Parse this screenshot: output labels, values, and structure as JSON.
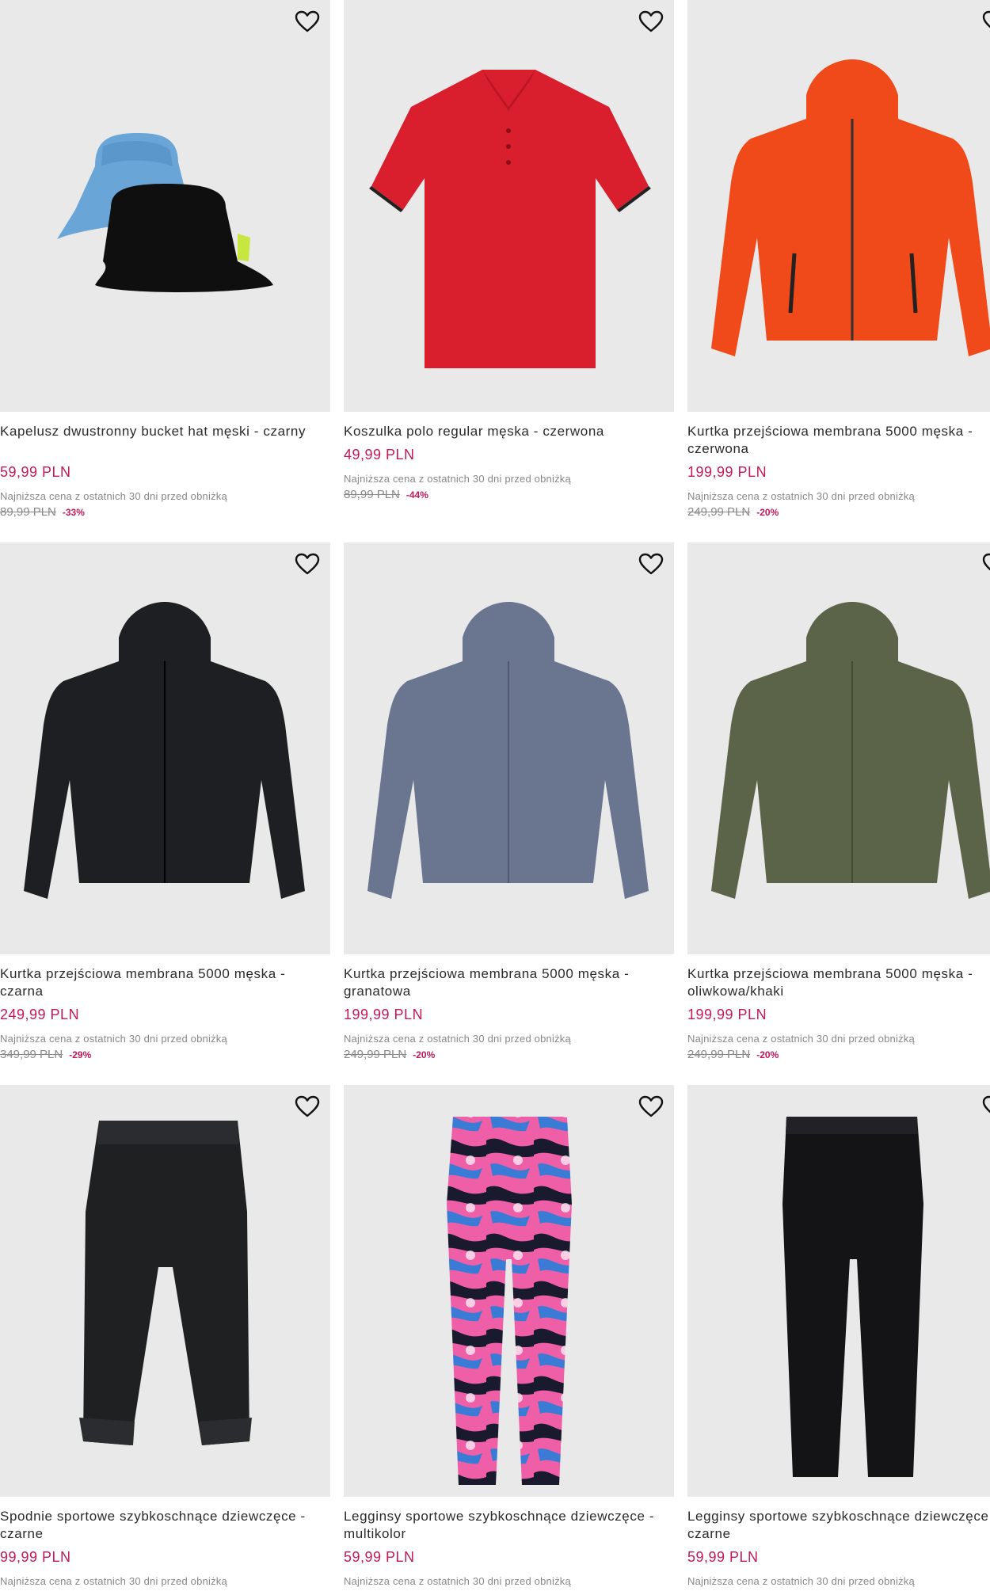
{
  "colors": {
    "price": "#c2185b",
    "tile_bg": "#e9e9e9",
    "muted": "#888888"
  },
  "icons": {
    "favorite": "heart-outline-icon"
  },
  "products": [
    {
      "name": "Kapelusz dwustronny bucket hat męski - czarny",
      "price": "59,99 PLN",
      "lowest_label": "Najniższa cena z ostatnich 30 dni przed obniżką",
      "old_price": "89,99 PLN",
      "discount": "-33%"
    },
    {
      "name": "Koszulka polo regular męska - czerwona",
      "price": "49,99 PLN",
      "lowest_label": "Najniższa cena z ostatnich 30 dni przed obniżką",
      "old_price": "89,99 PLN",
      "discount": "-44%"
    },
    {
      "name": "Kurtka przejściowa membrana 5000 męska - czerwona",
      "price": "199,99 PLN",
      "lowest_label": "Najniższa cena z ostatnich 30 dni przed obniżką",
      "old_price": "249,99 PLN",
      "discount": "-20%"
    },
    {
      "name": "Kurtka przejściowa membrana 5000 męska - czarna",
      "price": "249,99 PLN",
      "lowest_label": "Najniższa cena z ostatnich 30 dni przed obniżką",
      "old_price": "349,99 PLN",
      "discount": "-29%"
    },
    {
      "name": "Kurtka przejściowa membrana 5000 męska - granatowa",
      "price": "199,99 PLN",
      "lowest_label": "Najniższa cena z ostatnich 30 dni przed obniżką",
      "old_price": "249,99 PLN",
      "discount": "-20%"
    },
    {
      "name": "Kurtka przejściowa membrana 5000 męska - oliwkowa/khaki",
      "price": "199,99 PLN",
      "lowest_label": "Najniższa cena z ostatnich 30 dni przed obniżką",
      "old_price": "249,99 PLN",
      "discount": "-20%"
    },
    {
      "name": "Spodnie sportowe szybkoschnące dziewczęce - czarne",
      "price": "99,99 PLN",
      "lowest_label": "Najniższa cena z ostatnich 30 dni przed obniżką",
      "old_price": "",
      "discount": ""
    },
    {
      "name": "Legginsy sportowe szybkoschnące dziewczęce - multikolor",
      "price": "59,99 PLN",
      "lowest_label": "Najniższa cena z ostatnich 30 dni przed obniżką",
      "old_price": "",
      "discount": ""
    },
    {
      "name": "Legginsy sportowe szybkoschnące dziewczęce - czarne",
      "price": "59,99 PLN",
      "lowest_label": "Najniższa cena z ostatnich 30 dni przed obniżką",
      "old_price": "",
      "discount": ""
    }
  ]
}
